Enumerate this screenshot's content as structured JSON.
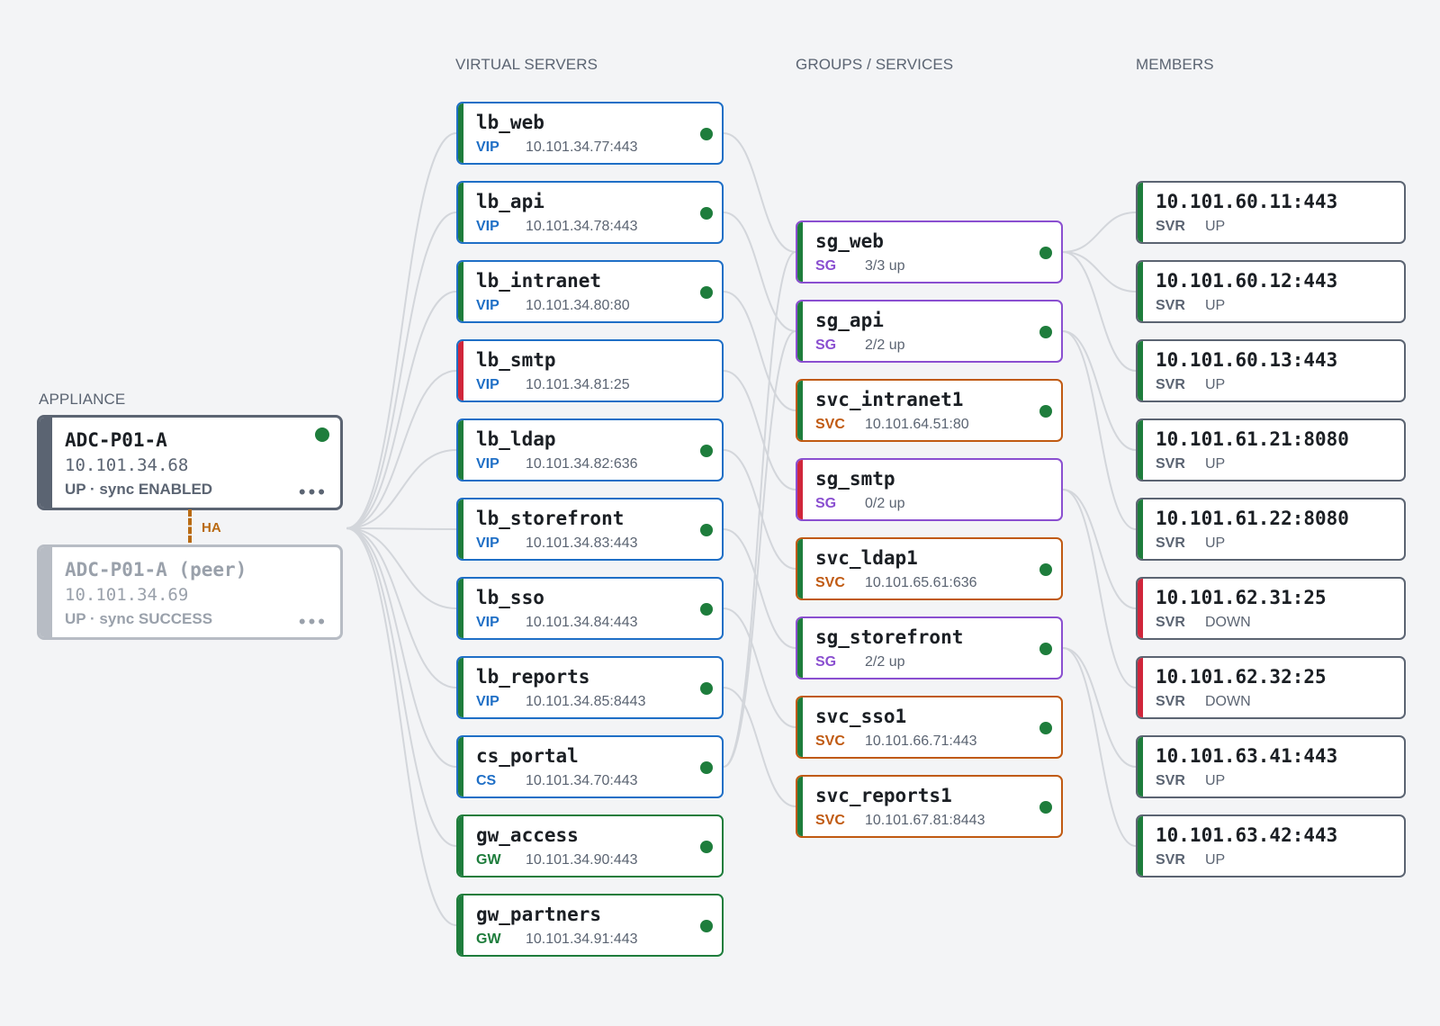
{
  "columns": {
    "appliance": "APPLIANCE",
    "virtual_servers": "VIRTUAL SERVERS",
    "groups": "GROUPS / SERVICES",
    "members": "MEMBERS"
  },
  "appliance": {
    "primary": {
      "name": "ADC-P01-A",
      "ip": "10.101.34.68",
      "status": "UP · sync ENABLED",
      "menu": "•••"
    },
    "peer": {
      "name": "ADC-P01-A (peer)",
      "ip": "10.101.34.69",
      "status": "UP · sync SUCCESS",
      "menu": "•••"
    },
    "ha_label": "HA"
  },
  "colors": {
    "up": "#1e7d3c",
    "down": "#d0263b",
    "vip": "#1f6fc6",
    "gw": "#1e7d3c",
    "sg": "#8a4fd0",
    "svc": "#c05a12",
    "svr": "#5b6472",
    "link": "#d3d6db",
    "ha": "#b96a12"
  },
  "virtual_servers": [
    {
      "name": "lb_web",
      "type": "VIP",
      "addr": "10.101.34.77:443",
      "status": "up"
    },
    {
      "name": "lb_api",
      "type": "VIP",
      "addr": "10.101.34.78:443",
      "status": "up"
    },
    {
      "name": "lb_intranet",
      "type": "VIP",
      "addr": "10.101.34.80:80",
      "status": "up"
    },
    {
      "name": "lb_smtp",
      "type": "VIP",
      "addr": "10.101.34.81:25",
      "status": "down"
    },
    {
      "name": "lb_ldap",
      "type": "VIP",
      "addr": "10.101.34.82:636",
      "status": "up"
    },
    {
      "name": "lb_storefront",
      "type": "VIP",
      "addr": "10.101.34.83:443",
      "status": "up"
    },
    {
      "name": "lb_sso",
      "type": "VIP",
      "addr": "10.101.34.84:443",
      "status": "up"
    },
    {
      "name": "lb_reports",
      "type": "VIP",
      "addr": "10.101.34.85:8443",
      "status": "up"
    },
    {
      "name": "cs_portal",
      "type": "CS",
      "addr": "10.101.34.70:443",
      "status": "up"
    },
    {
      "name": "gw_access",
      "type": "GW",
      "addr": "10.101.34.90:443",
      "status": "up"
    },
    {
      "name": "gw_partners",
      "type": "GW",
      "addr": "10.101.34.91:443",
      "status": "up"
    }
  ],
  "groups": [
    {
      "name": "sg_web",
      "type": "SG",
      "info": "3/3 up",
      "status": "up"
    },
    {
      "name": "sg_api",
      "type": "SG",
      "info": "2/2 up",
      "status": "up"
    },
    {
      "name": "svc_intranet1",
      "type": "SVC",
      "info": "10.101.64.51:80",
      "status": "up"
    },
    {
      "name": "sg_smtp",
      "type": "SG",
      "info": "0/2 up",
      "status": "down"
    },
    {
      "name": "svc_ldap1",
      "type": "SVC",
      "info": "10.101.65.61:636",
      "status": "up"
    },
    {
      "name": "sg_storefront",
      "type": "SG",
      "info": "2/2 up",
      "status": "up"
    },
    {
      "name": "svc_sso1",
      "type": "SVC",
      "info": "10.101.66.71:443",
      "status": "up"
    },
    {
      "name": "svc_reports1",
      "type": "SVC",
      "info": "10.101.67.81:8443",
      "status": "up"
    }
  ],
  "members": [
    {
      "name": "10.101.60.11:443",
      "type": "SVR",
      "state": "UP",
      "status": "up"
    },
    {
      "name": "10.101.60.12:443",
      "type": "SVR",
      "state": "UP",
      "status": "up"
    },
    {
      "name": "10.101.60.13:443",
      "type": "SVR",
      "state": "UP",
      "status": "up"
    },
    {
      "name": "10.101.61.21:8080",
      "type": "SVR",
      "state": "UP",
      "status": "up"
    },
    {
      "name": "10.101.61.22:8080",
      "type": "SVR",
      "state": "UP",
      "status": "up"
    },
    {
      "name": "10.101.62.31:25",
      "type": "SVR",
      "state": "DOWN",
      "status": "down"
    },
    {
      "name": "10.101.62.32:25",
      "type": "SVR",
      "state": "DOWN",
      "status": "down"
    },
    {
      "name": "10.101.63.41:443",
      "type": "SVR",
      "state": "UP",
      "status": "up"
    },
    {
      "name": "10.101.63.42:443",
      "type": "SVR",
      "state": "UP",
      "status": "up"
    }
  ],
  "links": {
    "vs_to_group": [
      [
        0,
        0
      ],
      [
        1,
        1
      ],
      [
        2,
        2
      ],
      [
        3,
        3
      ],
      [
        4,
        4
      ],
      [
        5,
        5
      ],
      [
        6,
        6
      ],
      [
        7,
        7
      ],
      [
        8,
        0
      ],
      [
        8,
        1
      ]
    ],
    "group_to_member": [
      [
        0,
        0
      ],
      [
        0,
        1
      ],
      [
        0,
        2
      ],
      [
        1,
        3
      ],
      [
        1,
        4
      ],
      [
        3,
        5
      ],
      [
        3,
        6
      ],
      [
        5,
        7
      ],
      [
        5,
        8
      ]
    ]
  }
}
